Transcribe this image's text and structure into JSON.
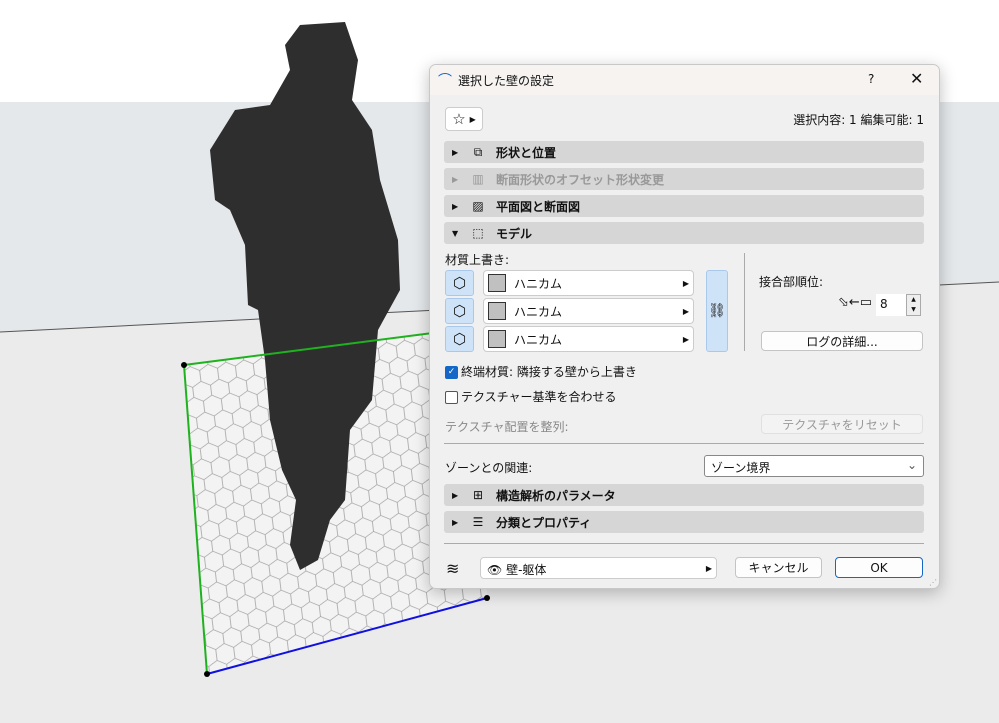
{
  "dialog": {
    "title": "選択した壁の設定",
    "help": "?",
    "close": "✕",
    "selection_info": "選択内容: 1 編集可能: 1"
  },
  "sections": [
    {
      "label": "形状と位置",
      "icon": "geometry-icon",
      "enabled": true,
      "expanded": false
    },
    {
      "label": "断面形状のオフセット形状変更",
      "icon": "profile-icon",
      "enabled": false,
      "expanded": false
    },
    {
      "label": "平面図と断面図",
      "icon": "floorplan-icon",
      "enabled": true,
      "expanded": false
    },
    {
      "label": "モデル",
      "icon": "model-icon",
      "enabled": true,
      "expanded": true
    },
    {
      "label": "構造解析のパラメータ",
      "icon": "structural-icon",
      "enabled": true,
      "expanded": false
    },
    {
      "label": "分類とプロパティ",
      "icon": "properties-icon",
      "enabled": true,
      "expanded": false
    }
  ],
  "model": {
    "override_label": "材質上書き:",
    "surfaces": [
      {
        "value": "ハニカム"
      },
      {
        "value": "ハニカム"
      },
      {
        "value": "ハニカム"
      }
    ],
    "junction_label": "接合部順位:",
    "junction_value": "8",
    "log_button": "ログの詳細...",
    "end_surface": {
      "label": "終端材質: 隣接する壁から上書き",
      "checked": true
    },
    "align_texture": {
      "label": "テクスチャー基準を合わせる",
      "checked": false
    },
    "texture_align_label": "テクスチャ配置を整列:",
    "reset_texture_button": "テクスチャをリセット",
    "zone_label": "ゾーンとの関連:",
    "zone_value": "ゾーン境界"
  },
  "footer": {
    "layer": "壁-躯体",
    "cancel": "キャンセル",
    "ok": "OK"
  },
  "colors": {
    "accent": "#1467c7",
    "wall_left": "#1fb21f",
    "wall_bottom": "#1010e0"
  }
}
